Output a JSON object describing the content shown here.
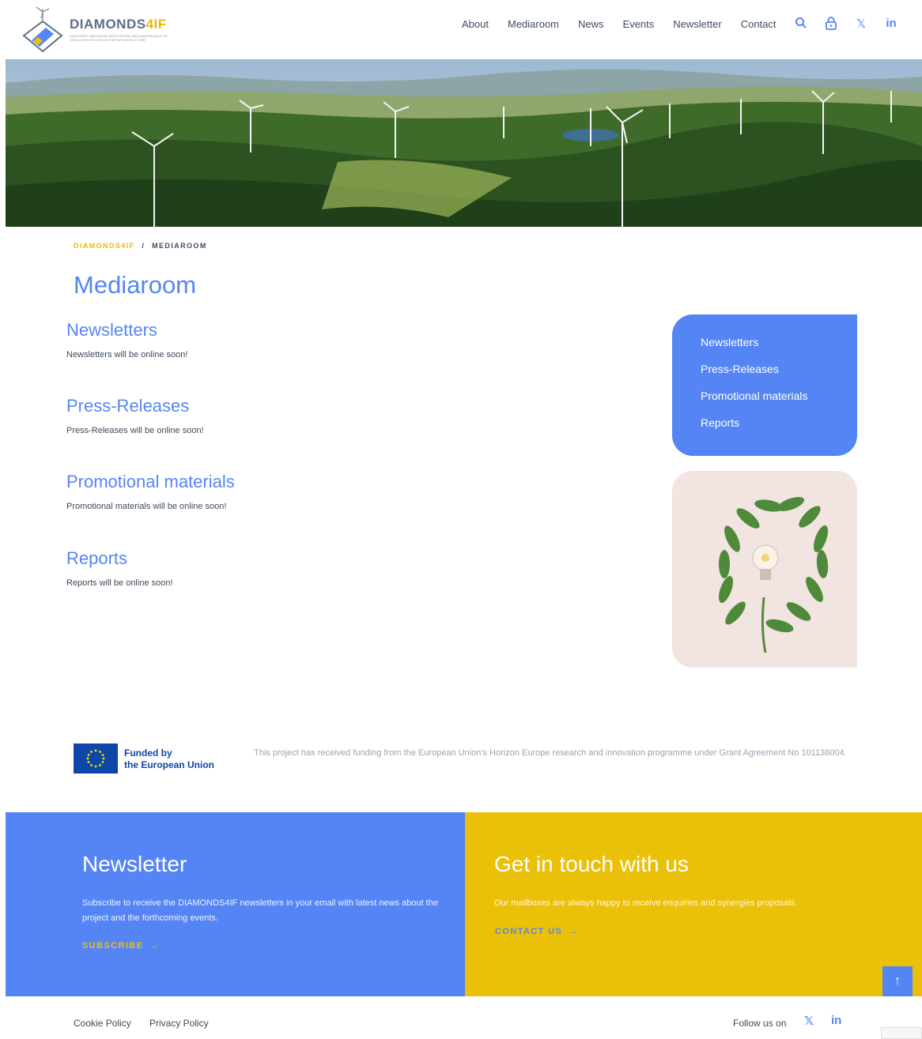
{
  "header": {
    "logo_text_main": "DIAMONDS",
    "logo_text_accent": "4IF",
    "logo_tagline": "DISCOVERY INNOVATIVE APPLICATIONS AND MAINTENANCE OF DEVELOPED SOLUTIONS FOR INFRASTRUCTURE",
    "nav": [
      "About",
      "Mediaroom",
      "News",
      "Events",
      "Newsletter",
      "Contact"
    ],
    "icons": [
      "search-icon",
      "lock-icon",
      "x-icon",
      "linkedin-icon"
    ],
    "icon_glyphs": {
      "x": "𝕏",
      "linkedin": "in"
    }
  },
  "breadcrumb": {
    "home": "DIAMONDS4IF",
    "separator": "/",
    "current": "MEDIAROOM"
  },
  "page": {
    "title": "Mediaroom",
    "sections": [
      {
        "heading": "Newsletters",
        "text": "Newsletters will be online soon!"
      },
      {
        "heading": "Press-Releases",
        "text": "Press-Releases will be online soon!"
      },
      {
        "heading": "Promotional materials",
        "text": "Promotional materials will be online soon!"
      },
      {
        "heading": "Reports",
        "text": "Reports will be online soon!"
      }
    ]
  },
  "sidebar": {
    "items": [
      "Newsletters",
      "Press-Releases",
      "Promotional materials",
      "Reports"
    ]
  },
  "funding": {
    "eu_line1": "Funded by",
    "eu_line2": "the European Union",
    "note": "This project has received funding from the European Union's Horizon Europe research and innovation programme under Grant Agreement No 101138004."
  },
  "newsletter_panel": {
    "title": "Newsletter",
    "text": "Subscribe to receive the DIAMONDS4IF newsletters in your email with latest news about the project and the forthcoming events.",
    "link": "SUBSCRIBE"
  },
  "contact_panel": {
    "title": "Get in touch with us",
    "text": "Our mailboxes are always happy to receive enquiries and synergies proposals.",
    "link": "CONTACT US"
  },
  "footer": {
    "cookie": "Cookie Policy",
    "privacy": "Privacy Policy",
    "follow": "Follow us on"
  },
  "colors": {
    "brand_blue": "#5585f5",
    "brand_yellow": "#eac009",
    "eu_blue": "#0e47a8"
  }
}
